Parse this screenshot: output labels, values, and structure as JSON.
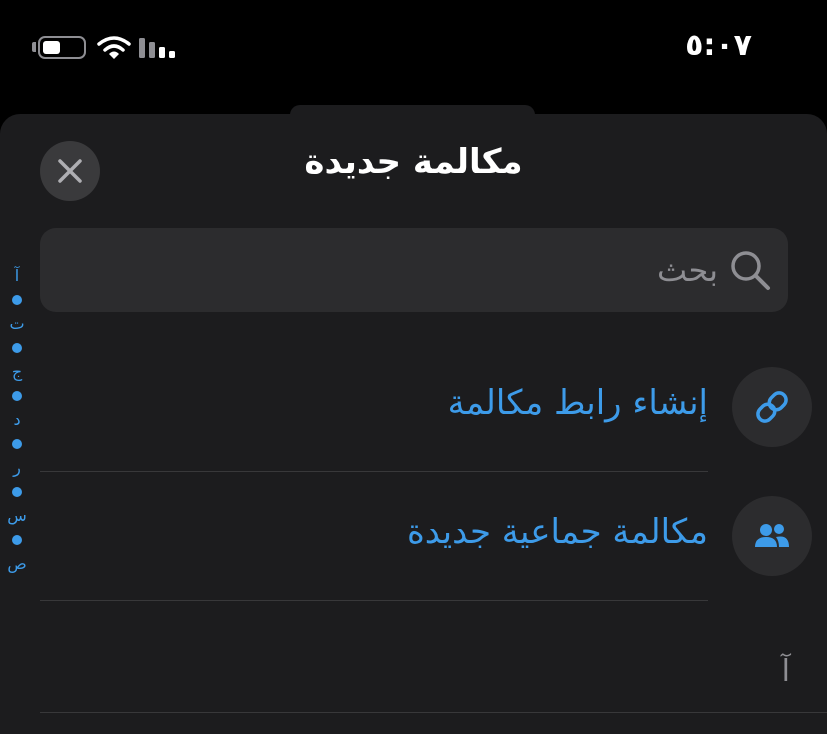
{
  "status_bar": {
    "time": "٥:٠٧",
    "battery_level": 0.45,
    "signal_bars": 2,
    "icons": [
      "battery-icon",
      "wifi-icon",
      "cellular-signal-icon"
    ]
  },
  "sheet": {
    "title": "مكالمة جديدة",
    "close_icon": "close-icon"
  },
  "search": {
    "placeholder": "بحث",
    "value": "",
    "icon": "search-icon"
  },
  "actions": [
    {
      "label": "إنشاء رابط مكالمة",
      "icon": "link-icon"
    },
    {
      "label": "مكالمة جماعية جديدة",
      "icon": "group-icon"
    }
  ],
  "contacts": {
    "section_letter": "آ"
  },
  "index_bar": {
    "letters": [
      "آ",
      "ت",
      "ج",
      "د",
      "ر",
      "س",
      "ص"
    ]
  },
  "colors": {
    "accent": "#3d9be9",
    "sheet_background": "#1c1c1e",
    "field_background": "#2c2c2e",
    "secondary_text": "#8e8e93"
  }
}
